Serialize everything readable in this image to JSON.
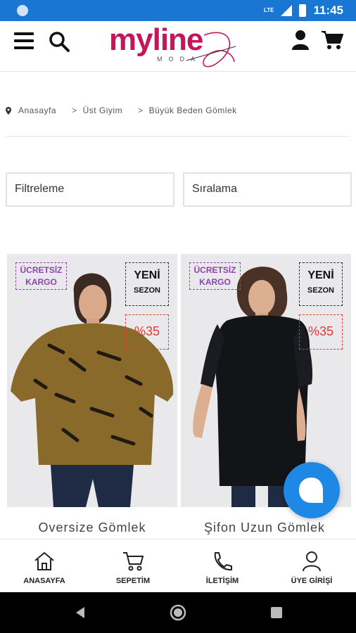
{
  "status_bar": {
    "time": "11:45",
    "network": "LTE"
  },
  "header": {
    "logo_text": "myline",
    "logo_sub": "MODA",
    "icons": [
      "menu-icon",
      "search-icon",
      "user-icon",
      "cart-icon"
    ]
  },
  "breadcrumb": {
    "items": [
      "Anasayfa",
      "Üst Giyim",
      "Büyük Beden Gömlek"
    ],
    "separator": ">"
  },
  "filters": {
    "filter_label": "Filtreleme",
    "sort_label": "Sıralama"
  },
  "products": [
    {
      "name": "Oversize Gömlek",
      "badge_shipping": [
        "ÜCRETSİZ",
        "KARGO"
      ],
      "badge_new": [
        "YENİ",
        "SEZON"
      ],
      "discount": "%35"
    },
    {
      "name": "Şifon Uzun Gömlek",
      "badge_shipping": [
        "ÜCRETSİZ",
        "KARGO"
      ],
      "badge_new": [
        "YENİ",
        "SEZON"
      ],
      "discount": "%35"
    }
  ],
  "bottom_nav": [
    {
      "label": "ANASAYFA",
      "icon": "home-icon"
    },
    {
      "label": "SEPETİM",
      "icon": "cart-icon"
    },
    {
      "label": "İLETİŞİM",
      "icon": "phone-icon"
    },
    {
      "label": "ÜYE GİRİŞİ",
      "icon": "user-icon"
    }
  ],
  "colors": {
    "status_bar": "#1976d2",
    "brand": "#c2185b",
    "kargo_badge": "#8e44ad",
    "discount": "#e53935",
    "chat_fab": "#1e88e5"
  }
}
